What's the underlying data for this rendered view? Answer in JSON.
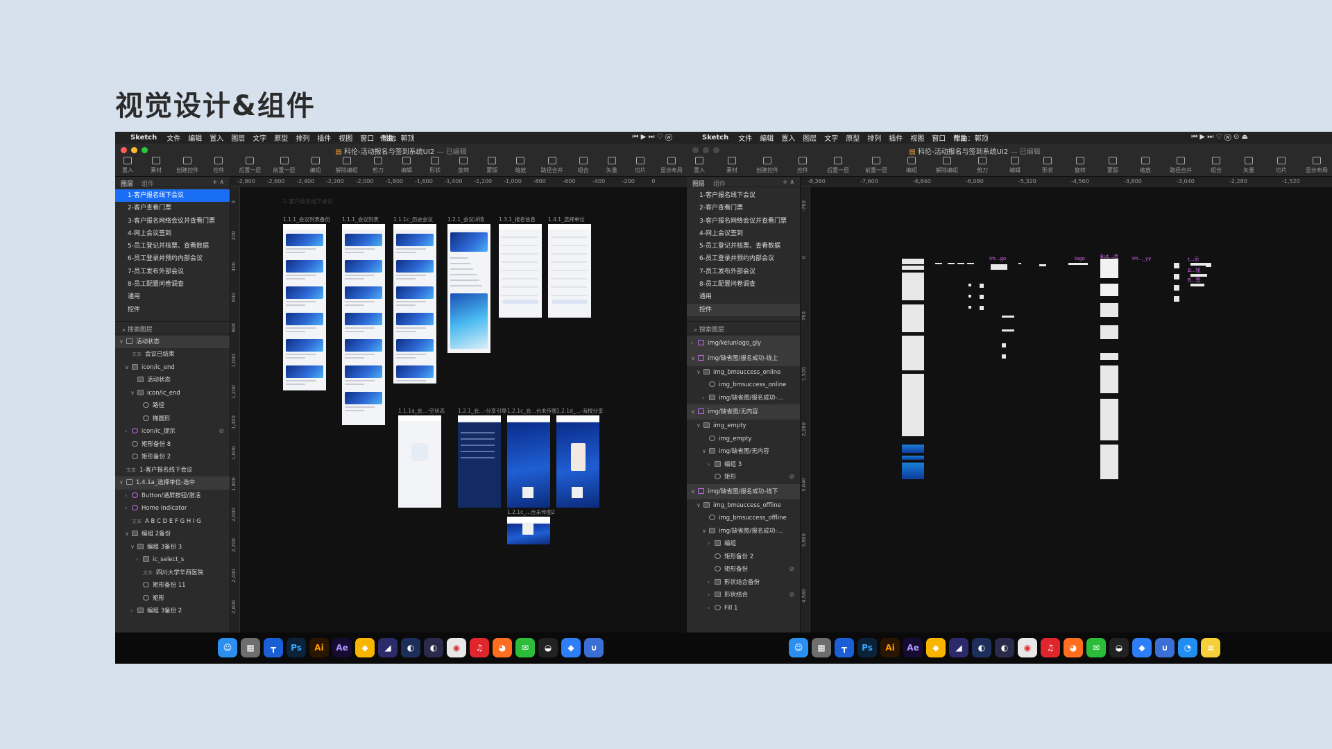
{
  "heading": "视觉设计&组件",
  "menubar": {
    "apple": "",
    "app": "Sketch",
    "items": [
      "文件",
      "编辑",
      "置入",
      "图层",
      "文字",
      "原型",
      "排列",
      "插件",
      "视图",
      "窗口",
      "帮助"
    ],
    "author": "作曲：郭顶",
    "status_a": "⏮ ▶ ⏭ ♡ ⓦ",
    "status_b": "⏮ ▶ ⏭ ♡ ⓦ  ⊙ ⏏"
  },
  "document_title": "科伦-活动报名与签到系统UI2",
  "document_status": "— 已编辑",
  "toolbar": [
    "置入",
    "素材",
    "创建控件",
    "控件",
    "后置一层",
    "前置一层",
    "编组",
    "解除编组",
    "剪刀",
    "编辑",
    "形状",
    "旋转",
    "蒙版",
    "缩放",
    "路径合并",
    "组合",
    "矢量",
    "切片",
    "显示布局"
  ],
  "panel_tabs": [
    "图层",
    "组件"
  ],
  "pages": [
    "1-客户报名线下会议",
    "2-客户查看门票",
    "3-客户报名网络会议并查看门票",
    "4-网上会议签到",
    "5-员工登记并核票、查看数据",
    "6-员工登录并预约内部会议",
    "7-员工发布外部会议",
    "8-员工配置问卷调查",
    "通用",
    "控件"
  ],
  "search_placeholder": "搜索图层",
  "layers_a": [
    {
      "t": "活动状态",
      "k": "hdr",
      "i": "art",
      "d": 0,
      "c": "∨"
    },
    {
      "t": "会议已结束",
      "i": "txt",
      "d": 1,
      "c": ""
    },
    {
      "t": "icon/ic_end",
      "i": "grp",
      "d": 1,
      "c": "∨"
    },
    {
      "t": "活动状态",
      "i": "grp",
      "d": 2,
      "c": ""
    },
    {
      "t": "icon/ic_end",
      "i": "grp",
      "d": 2,
      "c": "∨"
    },
    {
      "t": "路径",
      "i": "shp",
      "d": 3,
      "c": ""
    },
    {
      "t": "椭圆形",
      "i": "shp",
      "d": 3,
      "c": ""
    },
    {
      "t": "icon/ic_提示",
      "i": "sym",
      "d": 1,
      "c": "›",
      "eye": true
    },
    {
      "t": "矩形备份 8",
      "i": "shp",
      "d": 1,
      "c": ""
    },
    {
      "t": "矩形备份 2",
      "i": "shp",
      "d": 1,
      "c": ""
    },
    {
      "t": "1-客户报名线下会议",
      "i": "txt",
      "d": 0,
      "c": ""
    },
    {
      "t": "1.4.1a_选择单位-选中",
      "k": "hdr",
      "i": "art",
      "d": 0,
      "c": "∨"
    },
    {
      "t": "Button/通屏按钮/激活",
      "i": "sym",
      "d": 1,
      "c": "›"
    },
    {
      "t": "Home Indicator",
      "i": "sym",
      "d": 1,
      "c": "›"
    },
    {
      "t": "A B C D E F G H I G",
      "i": "txt",
      "d": 1,
      "c": ""
    },
    {
      "t": "编组 2备份",
      "i": "grp",
      "d": 1,
      "c": "∨"
    },
    {
      "t": "编组 3备份 3",
      "i": "grp",
      "d": 2,
      "c": "∨"
    },
    {
      "t": "ic_select_s",
      "i": "grp",
      "d": 3,
      "c": "›"
    },
    {
      "t": "四川大学华西医院",
      "i": "txt",
      "d": 3,
      "c": ""
    },
    {
      "t": "矩形备份 11",
      "i": "shp",
      "d": 3,
      "c": ""
    },
    {
      "t": "矩形",
      "i": "shp",
      "d": 3,
      "c": ""
    },
    {
      "t": "编组 3备份 2",
      "i": "grp",
      "d": 2,
      "c": "›"
    }
  ],
  "layers_b": [
    {
      "t": "img/kelunlogo_gly",
      "k": "magh",
      "i": "art",
      "d": 0,
      "c": "›"
    },
    {
      "t": "img/缺省图/报名成功-线上",
      "k": "magh",
      "i": "art",
      "d": 0,
      "c": "∨"
    },
    {
      "t": "img_bmsuccess_online",
      "i": "grp",
      "d": 1,
      "c": "∨"
    },
    {
      "t": "img_bmsuccess_online",
      "i": "shp",
      "d": 2,
      "c": ""
    },
    {
      "t": "img/缺省图/报名成功-...",
      "i": "grp",
      "d": 2,
      "c": "›"
    },
    {
      "t": "img/缺省图/无内容",
      "k": "magh",
      "i": "art",
      "d": 0,
      "c": "∨"
    },
    {
      "t": "img_empty",
      "i": "grp",
      "d": 1,
      "c": "∨"
    },
    {
      "t": "img_empty",
      "i": "shp",
      "d": 2,
      "c": ""
    },
    {
      "t": "img/缺省图/无内容",
      "i": "grp",
      "d": 2,
      "c": "∨"
    },
    {
      "t": "编组 3",
      "i": "grp",
      "d": 3,
      "c": "›"
    },
    {
      "t": "矩形",
      "i": "shp",
      "d": 3,
      "c": "",
      "eye": true
    },
    {
      "t": "img/缺省图/报名成功-线下",
      "k": "magh",
      "i": "art",
      "d": 0,
      "c": "∨"
    },
    {
      "t": "img_bmsuccess_offline",
      "i": "grp",
      "d": 1,
      "c": "∨"
    },
    {
      "t": "img_bmsuccess_offline",
      "i": "shp",
      "d": 2,
      "c": ""
    },
    {
      "t": "img/缺省图/报名成功-...",
      "i": "grp",
      "d": 2,
      "c": "∨"
    },
    {
      "t": "编组",
      "i": "grp",
      "d": 3,
      "c": "›"
    },
    {
      "t": "矩形备份 2",
      "i": "shp",
      "d": 3,
      "c": ""
    },
    {
      "t": "矩形备份",
      "i": "shp",
      "d": 3,
      "c": "",
      "eye": true
    },
    {
      "t": "形状结合备份",
      "i": "grp",
      "d": 3,
      "c": "›"
    },
    {
      "t": "形状结合",
      "i": "grp",
      "d": 3,
      "c": "›",
      "eye": true
    },
    {
      "t": "Fill 1",
      "i": "shp",
      "d": 3,
      "c": "›"
    }
  ],
  "ruler_top_a": [
    "-2,800",
    "-2,600",
    "-2,400",
    "-2,200",
    "-2,000",
    "-1,800",
    "-1,600",
    "-1,400",
    "-1,200",
    "-1,000",
    "-800",
    "-600",
    "-400",
    "-200",
    "0"
  ],
  "ruler_left_a": [
    "0",
    "200",
    "400",
    "600",
    "800",
    "1,000",
    "1,200",
    "1,400",
    "1,600",
    "1,800",
    "2,000",
    "2,200",
    "2,400",
    "2,600"
  ],
  "ruler_top_b": [
    "-8,360",
    "-7,600",
    "-6,840",
    "-6,080",
    "-5,320",
    "-4,560",
    "-3,800",
    "-3,040",
    "-2,280",
    "-1,520"
  ],
  "ruler_left_b": [
    "-760",
    "0",
    "760",
    "1,520",
    "2,280",
    "3,040",
    "3,800",
    "4,560"
  ],
  "canvas_a_page_label": "1-客户报名线下会议",
  "artboards_a": [
    {
      "cap": "1.1.1_会议列表备份",
      "kind": "list"
    },
    {
      "cap": "1.1.1_会议列表",
      "kind": "list"
    },
    {
      "cap": "1.1.1c_历史会议",
      "kind": "list"
    },
    {
      "cap": "1.2.1_会议详情",
      "kind": "detail"
    },
    {
      "cap": "1.3.1_报名信息",
      "kind": "form"
    },
    {
      "cap": "1.4.1_选择单位",
      "kind": "form"
    },
    {
      "cap": "1.1.1a_会...-空状态",
      "kind": "empty"
    },
    {
      "cap": "1.2.1_会...-分享引导",
      "kind": "share"
    },
    {
      "cap": "1.2.1c_会...台未传图",
      "kind": "poster"
    },
    {
      "cap": "1.2.1d_...-海报分享",
      "kind": "poster2"
    },
    {
      "cap": "1.2.1c_...台未传图2",
      "kind": "poster"
    }
  ],
  "canvas_b_labels": [
    "im...go",
    "logo",
    "But...活",
    "im..._yy",
    "t...示",
    "B...钮",
    "B...签"
  ],
  "dock_a": [
    {
      "icon": "finder-icon",
      "glyph": "☺",
      "bg": "#2b8ff0"
    },
    {
      "icon": "launchpad-icon",
      "glyph": "▦",
      "bg": "#6e6e6e"
    },
    {
      "icon": "keynote-icon",
      "glyph": "┳",
      "bg": "#1a5fd6"
    },
    {
      "icon": "photoshop-icon",
      "glyph": "Ps",
      "bg": "#0b2238",
      "fg": "#36a8ff"
    },
    {
      "icon": "illustrator-icon",
      "glyph": "Ai",
      "bg": "#2a1500",
      "fg": "#ff9a00"
    },
    {
      "icon": "after-effects-icon",
      "glyph": "Ae",
      "bg": "#180b33",
      "fg": "#a99cff"
    },
    {
      "icon": "sketch-icon",
      "glyph": "◆",
      "bg": "#f7b500"
    },
    {
      "icon": "axure-icon",
      "glyph": "◢",
      "bg": "#2b2b6b"
    },
    {
      "icon": "cinema4d-icon",
      "glyph": "◐",
      "bg": "#1e2e5a"
    },
    {
      "icon": "cinema4d-alt-icon",
      "glyph": "◐",
      "bg": "#2a2a4a"
    },
    {
      "icon": "chrome-icon",
      "glyph": "◉",
      "bg": "#e8e8e8",
      "fg": "#d33"
    },
    {
      "icon": "netease-music-icon",
      "glyph": "♫",
      "bg": "#e0262d"
    },
    {
      "icon": "firefox-icon",
      "glyph": "◕",
      "bg": "#ff6d1f"
    },
    {
      "icon": "wechat-icon",
      "glyph": "✉",
      "bg": "#2bbd3a"
    },
    {
      "icon": "qq-icon",
      "glyph": "◒",
      "bg": "#222"
    },
    {
      "icon": "lanhu-icon",
      "glyph": "◆",
      "bg": "#2d7ef7"
    },
    {
      "icon": "magnet-icon",
      "glyph": "∪",
      "bg": "#3b6fd6"
    }
  ],
  "dock_b": [
    {
      "icon": "finder-icon",
      "glyph": "☺",
      "bg": "#2b8ff0"
    },
    {
      "icon": "launchpad-icon",
      "glyph": "▦",
      "bg": "#6e6e6e"
    },
    {
      "icon": "keynote-icon",
      "glyph": "┳",
      "bg": "#1a5fd6"
    },
    {
      "icon": "photoshop-icon",
      "glyph": "Ps",
      "bg": "#0b2238",
      "fg": "#36a8ff"
    },
    {
      "icon": "illustrator-icon",
      "glyph": "Ai",
      "bg": "#2a1500",
      "fg": "#ff9a00"
    },
    {
      "icon": "after-effects-icon",
      "glyph": "Ae",
      "bg": "#180b33",
      "fg": "#a99cff"
    },
    {
      "icon": "sketch-icon",
      "glyph": "◆",
      "bg": "#f7b500"
    },
    {
      "icon": "axure-icon",
      "glyph": "◢",
      "bg": "#2b2b6b"
    },
    {
      "icon": "cinema4d-icon",
      "glyph": "◐",
      "bg": "#1e2e5a"
    },
    {
      "icon": "cinema4d-alt-icon",
      "glyph": "◐",
      "bg": "#2a2a4a"
    },
    {
      "icon": "chrome-icon",
      "glyph": "◉",
      "bg": "#e8e8e8",
      "fg": "#d33"
    },
    {
      "icon": "netease-music-icon",
      "glyph": "♫",
      "bg": "#e0262d"
    },
    {
      "icon": "firefox-icon",
      "glyph": "◕",
      "bg": "#ff6d1f"
    },
    {
      "icon": "wechat-icon",
      "glyph": "✉",
      "bg": "#2bbd3a"
    },
    {
      "icon": "qq-icon",
      "glyph": "◒",
      "bg": "#222"
    },
    {
      "icon": "lanhu-icon",
      "glyph": "◆",
      "bg": "#2d7ef7"
    },
    {
      "icon": "magnet-icon",
      "glyph": "∪",
      "bg": "#3b6fd6"
    },
    {
      "icon": "quicktime-icon",
      "glyph": "◔",
      "bg": "#1f8ef0"
    },
    {
      "icon": "notes-icon",
      "glyph": "≡",
      "bg": "#f6cf3a"
    }
  ],
  "colors": {
    "selection": "#1a6ef5",
    "window_red": "#ff5f57",
    "window_yellow": "#febc2e",
    "window_green": "#28c840",
    "symbol": "#c06be8",
    "background": "#d7e1ee"
  }
}
